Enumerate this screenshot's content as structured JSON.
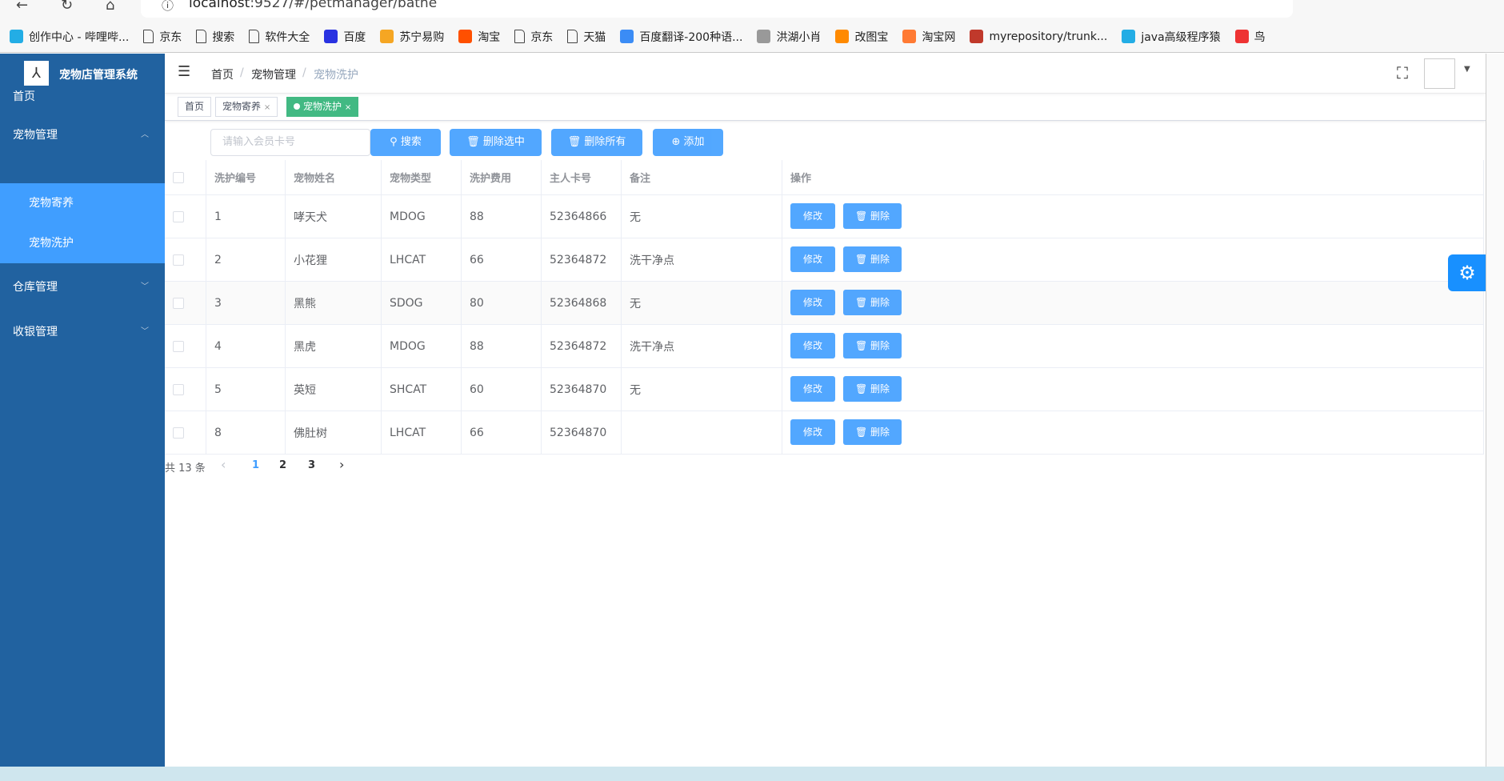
{
  "browser": {
    "url_host": "localhost",
    "url_rest": ":9527/#/petmanager/bathe",
    "bookmarks": [
      {
        "label": "创作中心 - 哔哩哔...",
        "icon": "bilibili-icon",
        "color": "#23ade5"
      },
      {
        "label": "京东",
        "icon": "page-icon",
        "color": ""
      },
      {
        "label": "搜索",
        "icon": "page-icon",
        "color": ""
      },
      {
        "label": "软件大全",
        "icon": "page-icon",
        "color": ""
      },
      {
        "label": "百度",
        "icon": "baidu-icon",
        "color": "#2932e1"
      },
      {
        "label": "苏宁易购",
        "icon": "suning-icon",
        "color": "#f5a623"
      },
      {
        "label": "淘宝",
        "icon": "taobao-icon",
        "color": "#ff5000"
      },
      {
        "label": "京东",
        "icon": "page-icon",
        "color": ""
      },
      {
        "label": "天猫",
        "icon": "page-icon",
        "color": ""
      },
      {
        "label": "百度翻译-200种语...",
        "icon": "translate-icon",
        "color": "#3b8cf5"
      },
      {
        "label": "洪湖小肖",
        "icon": "bird-icon",
        "color": "#999"
      },
      {
        "label": "改图宝",
        "icon": "gaitubao-icon",
        "color": "#ff8a00"
      },
      {
        "label": "淘宝网",
        "icon": "taobao-icon",
        "color": "#ff7a33"
      },
      {
        "label": "myrepository/trunk...",
        "icon": "repo-icon",
        "color": "#c0392b"
      },
      {
        "label": "java高级程序猿",
        "icon": "bilibili-icon",
        "color": "#23ade5"
      },
      {
        "label": "鸟",
        "icon": "bird-red-icon",
        "color": "#e33"
      }
    ]
  },
  "sidebar": {
    "brand": "宠物店管理系统",
    "items": [
      {
        "label": "首页"
      },
      {
        "label": "宠物管理",
        "chevron": "up"
      },
      {
        "label": "宠物寄养"
      },
      {
        "label": "宠物洗护"
      },
      {
        "label": "仓库管理",
        "chevron": "down"
      },
      {
        "label": "收银管理",
        "chevron": "down"
      }
    ]
  },
  "breadcrumb": [
    "首页",
    "宠物管理",
    "宠物洗护"
  ],
  "tags": [
    {
      "label": "首页"
    },
    {
      "label": "宠物寄养",
      "close": "×"
    },
    {
      "label": "宠物洗护",
      "close": "×"
    }
  ],
  "toolbar": {
    "placeholder": "请输入会员卡号",
    "search": "搜索",
    "delete_selected": "删除选中",
    "delete_all": "删除所有",
    "add": "添加"
  },
  "table": {
    "headers": [
      "洗护编号",
      "宠物姓名",
      "宠物类型",
      "洗护费用",
      "主人卡号",
      "备注",
      "操作"
    ],
    "rows": [
      [
        "1",
        "哮天犬",
        "MDOG",
        "88",
        "52364866",
        "无"
      ],
      [
        "2",
        "小花狸",
        "LHCAT",
        "66",
        "52364872",
        "洗干净点"
      ],
      [
        "3",
        "黑熊",
        "SDOG",
        "80",
        "52364868",
        "无"
      ],
      [
        "4",
        "黑虎",
        "MDOG",
        "88",
        "52364872",
        "洗干净点"
      ],
      [
        "5",
        "英短",
        "SHCAT",
        "60",
        "52364870",
        "无"
      ],
      [
        "8",
        "佛肚树",
        "LHCAT",
        "66",
        "52364870",
        ""
      ]
    ],
    "edit": "修改",
    "delete": "删除"
  },
  "pagination": {
    "total": "共 13 条",
    "pages": [
      "1",
      "2",
      "3"
    ],
    "current": "1",
    "prev": "‹",
    "next": "›"
  },
  "colors": {
    "sidebar": "#2162a0",
    "primary": "#409eff",
    "tag_active": "#42b983"
  }
}
